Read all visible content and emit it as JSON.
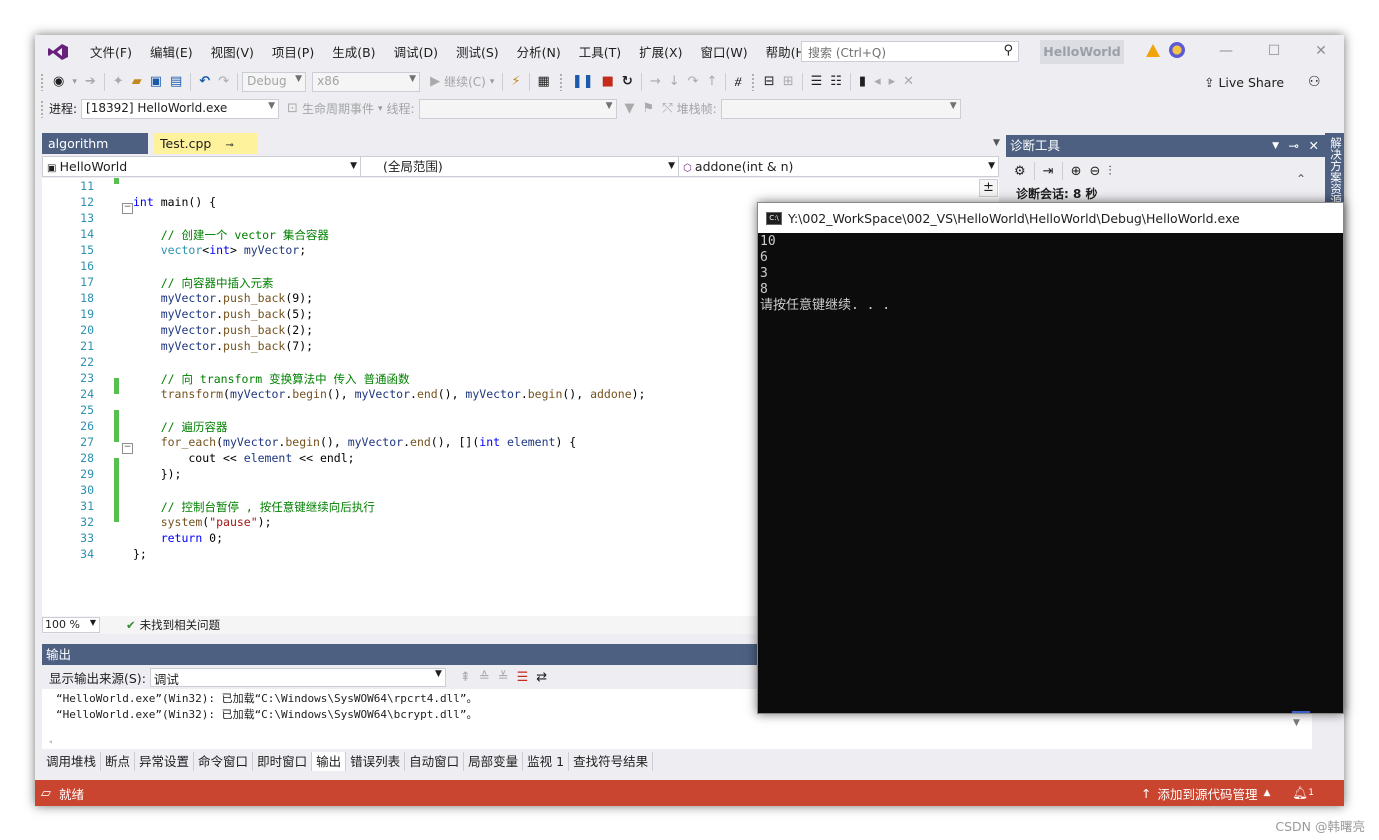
{
  "menu": {
    "items": [
      "文件(F)",
      "编辑(E)",
      "视图(V)",
      "项目(P)",
      "生成(B)",
      "调试(D)",
      "测试(S)",
      "分析(N)",
      "工具(T)",
      "扩展(X)",
      "窗口(W)",
      "帮助(H)"
    ],
    "search_placeholder": "搜索 (Ctrl+Q)",
    "solution_title": "HelloWorld"
  },
  "toolbar": {
    "config": "Debug",
    "platform": "x86",
    "continue_label": "继续(C)",
    "live_share": "Live Share"
  },
  "debug_location": {
    "process_label": "进程:",
    "process_value": "[18392] HelloWorld.exe",
    "lifecycle_label": "生命周期事件",
    "thread_label": "线程:",
    "stack_label": "堆栈帧:"
  },
  "doc_tabs": [
    {
      "label": "algorithm"
    },
    {
      "label": "Test.cpp",
      "pin": "⊸",
      "close": "✕"
    }
  ],
  "navbar": {
    "project": "HelloWorld",
    "scope": "(全局范围)",
    "member": "addone(int & n)"
  },
  "code": {
    "lines": [
      {
        "n": "11",
        "t": ""
      },
      {
        "n": "12",
        "t": "int main() {"
      },
      {
        "n": "13",
        "t": ""
      },
      {
        "n": "14",
        "t": "    // 创建一个 vector 集合容器"
      },
      {
        "n": "15",
        "t": "    vector<int> myVector;"
      },
      {
        "n": "16",
        "t": ""
      },
      {
        "n": "17",
        "t": "    // 向容器中插入元素"
      },
      {
        "n": "18",
        "t": "    myVector.push_back(9);"
      },
      {
        "n": "19",
        "t": "    myVector.push_back(5);"
      },
      {
        "n": "20",
        "t": "    myVector.push_back(2);"
      },
      {
        "n": "21",
        "t": "    myVector.push_back(7);"
      },
      {
        "n": "22",
        "t": ""
      },
      {
        "n": "23",
        "t": "    // 向 transform 变换算法中 传入 普通函数"
      },
      {
        "n": "24",
        "t": "    transform(myVector.begin(), myVector.end(), myVector.begin(), addone);"
      },
      {
        "n": "25",
        "t": ""
      },
      {
        "n": "26",
        "t": "    // 遍历容器"
      },
      {
        "n": "27",
        "t": "    for_each(myVector.begin(), myVector.end(), [](int element) {"
      },
      {
        "n": "28",
        "t": "        cout << element << endl;"
      },
      {
        "n": "29",
        "t": "    });"
      },
      {
        "n": "30",
        "t": ""
      },
      {
        "n": "31",
        "t": "    // 控制台暂停 , 按任意键继续向后执行"
      },
      {
        "n": "32",
        "t": "    system(\"pause\");"
      },
      {
        "n": "33",
        "t": "    return 0;"
      },
      {
        "n": "34",
        "t": "};"
      }
    ]
  },
  "editor_status": {
    "zoom": "100 %",
    "issues": "未找到相关问题"
  },
  "output": {
    "title": "输出",
    "source_label": "显示输出来源(S):",
    "source_value": "调试",
    "lines": [
      "“HelloWorld.exe”(Win32): 已加载“C:\\Windows\\SysWOW64\\rpcrt4.dll”。",
      "“HelloWorld.exe”(Win32): 已加载“C:\\Windows\\SysWOW64\\bcrypt.dll”。"
    ]
  },
  "bottom_tabs": [
    "调用堆栈",
    "断点",
    "异常设置",
    "命令窗口",
    "即时窗口",
    "输出",
    "错误列表",
    "自动窗口",
    "局部变量",
    "监视 1",
    "查找符号结果"
  ],
  "status": {
    "ready": "就绪",
    "source_control": "添加到源代码管理",
    "notif_count": "1"
  },
  "diagnostics": {
    "title": "诊断工具",
    "session": "诊断会话: 8 秒",
    "side_tab": "解决方案资源管"
  },
  "console": {
    "title": "Y:\\002_WorkSpace\\002_VS\\HelloWorld\\HelloWorld\\Debug\\HelloWorld.exe",
    "icon_text": "C:\\",
    "lines": [
      "10",
      "6",
      "3",
      "8",
      "请按任意键继续. . ."
    ]
  },
  "watermark": "CSDN @韩曙亮",
  "colors": {
    "chrome": "#eeeef2",
    "accent": "#4d6082",
    "active_tab": "#fff29d",
    "status_bar": "#c9452f",
    "console_bg": "#0c0c0c",
    "change_marker": "#57c04e"
  }
}
